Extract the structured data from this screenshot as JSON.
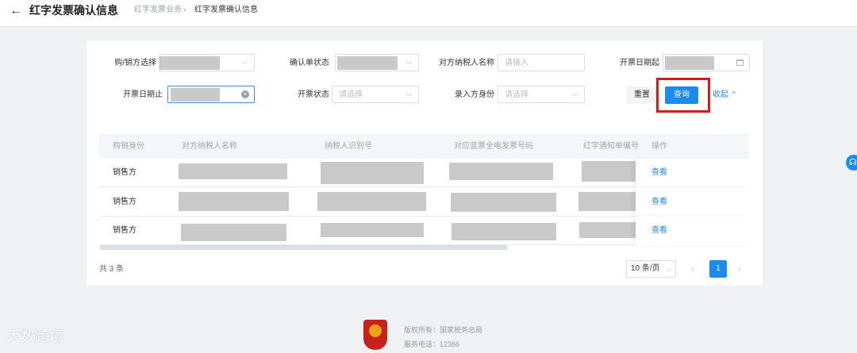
{
  "header": {
    "title": "红字发票确认信息",
    "breadcrumb": [
      "红字发票业务",
      "›",
      "红字发票确认信息"
    ]
  },
  "filters": {
    "buyer_seller_label": "购/销方选择",
    "confirm_status_label": "确认单状态",
    "counterparty_name_label": "对方纳税人名称",
    "counterparty_name_placeholder": "请输入",
    "date_start_label": "开票日期起",
    "date_end_label": "开票日期止",
    "invoice_status_label": "开票状态",
    "invoice_status_placeholder": "请选择",
    "entry_identity_label": "录入方身份",
    "entry_identity_placeholder": "请选择"
  },
  "actions": {
    "reset_label": "重置",
    "query_label": "查询",
    "collapse_label": "收起"
  },
  "table": {
    "columns": [
      "购销身份",
      "对方纳税人名称",
      "纳税人识别号",
      "对应蓝票全电发票号码",
      "红字通知单编号",
      "操作"
    ],
    "rows": [
      {
        "role": "销售方",
        "action": "查看"
      },
      {
        "role": "销售方",
        "action": "查看"
      },
      {
        "role": "销售方",
        "action": "查看"
      }
    ]
  },
  "pagination": {
    "total": "共 3 条",
    "page_size": "10 条/页",
    "current_page": "1"
  },
  "footer": {
    "copyright": "版权所有：国家税务总局",
    "phone": "服务电话：12366"
  },
  "watermark": "大数跨境",
  "colors": {
    "primary": "#1a8cf0",
    "highlight": "#d31a1f",
    "page_bg": "#f0f1f3"
  }
}
